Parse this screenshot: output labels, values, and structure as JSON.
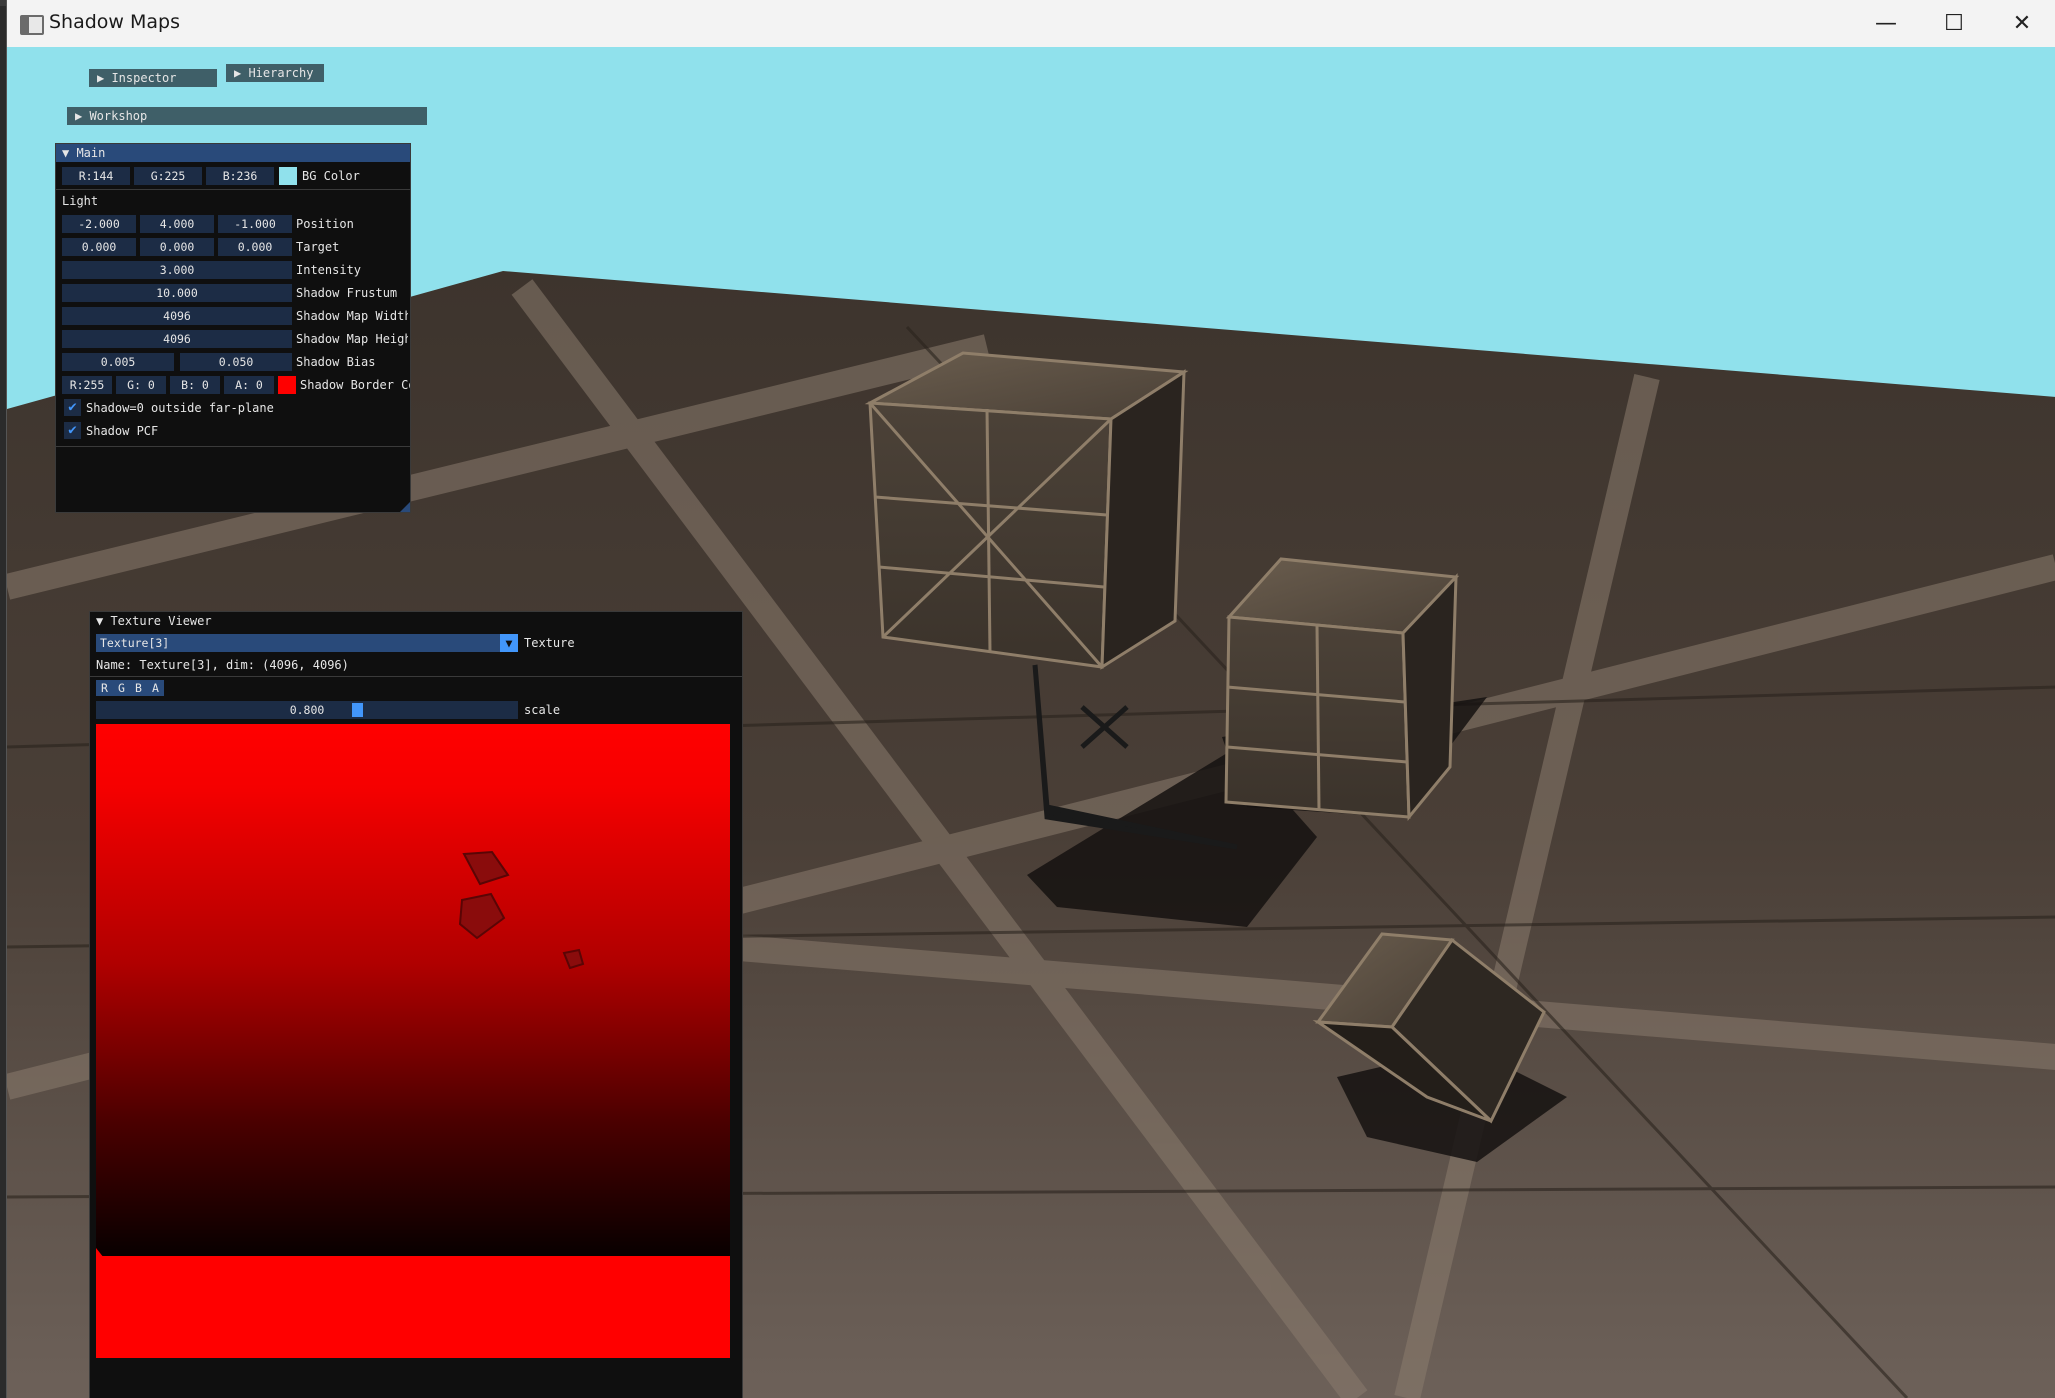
{
  "window": {
    "title": "Shadow Maps",
    "controls": {
      "minimize": "—",
      "maximize": "☐",
      "close": "✕"
    }
  },
  "colors": {
    "sky": "#90e1ec",
    "panel_bg": "#0f0f0f",
    "header_active": "#294a7a",
    "header_collapsed": "#3f5f68",
    "field_bg": "#1c2c45",
    "accent": "#4296fa",
    "shadow_border": "#ff0000"
  },
  "panels": {
    "inspector": {
      "label": "▶ Inspector"
    },
    "hierarchy": {
      "label": "▶ Hierarchy"
    },
    "workshop": {
      "label": "▶ Workshop"
    }
  },
  "main": {
    "title": "▼ Main",
    "bg_color": {
      "r": "R:144",
      "g": "G:225",
      "b": "B:236",
      "label": "BG Color",
      "swatch": "#90e1ec"
    },
    "light_section": "Light",
    "position": {
      "x": "-2.000",
      "y": "4.000",
      "z": "-1.000",
      "label": "Position"
    },
    "target": {
      "x": "0.000",
      "y": "0.000",
      "z": "0.000",
      "label": "Target"
    },
    "intensity": {
      "value": "3.000",
      "label": "Intensity"
    },
    "shadow_frustum": {
      "value": "10.000",
      "label": "Shadow Frustum"
    },
    "shadow_map_width": {
      "value": "4096",
      "label": "Shadow Map Width"
    },
    "shadow_map_height": {
      "value": "4096",
      "label": "Shadow Map Height"
    },
    "shadow_bias": {
      "min": "0.005",
      "max": "0.050",
      "label": "Shadow Bias"
    },
    "shadow_border": {
      "r": "R:255",
      "g": "G:  0",
      "b": "B:  0",
      "a": "A:  0",
      "label": "Shadow Border Color",
      "swatch": "#ff0000"
    },
    "checkbox_outside": {
      "checked": true,
      "label": "Shadow=0 outside far-plane"
    },
    "checkbox_pcf": {
      "checked": true,
      "label": "Shadow PCF"
    },
    "check_glyph": "✔"
  },
  "texture_viewer": {
    "title": "▼ Texture Viewer",
    "selected_texture": "Texture[3]",
    "combo_arrow": "▼",
    "combo_label": "Texture",
    "info": "Name: Texture[3], dim: (4096, 4096)",
    "channels": [
      "R",
      "G",
      "B",
      "A"
    ],
    "scale": {
      "value": "0.800",
      "label": "scale",
      "fraction": 0.8
    }
  }
}
